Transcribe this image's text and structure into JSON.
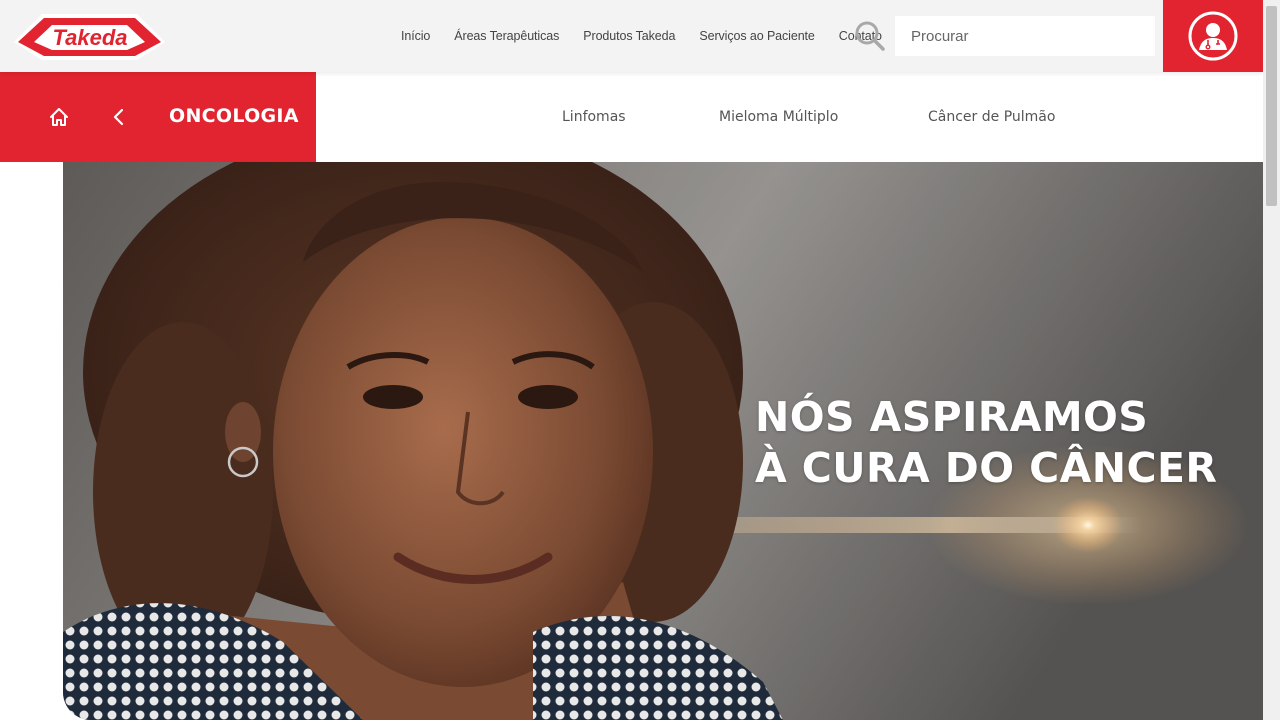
{
  "brand": {
    "name": "Takeda",
    "color": "#e1242f"
  },
  "topnav": {
    "items": [
      {
        "label": "Início"
      },
      {
        "label": "Áreas Terapêuticas"
      },
      {
        "label": "Produtos Takeda"
      },
      {
        "label": "Serviços ao Paciente"
      },
      {
        "label": "Contato"
      }
    ]
  },
  "search": {
    "placeholder": "Procurar",
    "icon": "search-icon"
  },
  "hcp": {
    "icon": "doctor-icon"
  },
  "subnav": {
    "title": "ONCOLOGIA",
    "home_icon": "home-icon",
    "back_icon": "chevron-left-icon",
    "items": [
      {
        "label": "Linfomas"
      },
      {
        "label": "Mieloma Múltiplo"
      },
      {
        "label": "Câncer de Pulmão"
      }
    ]
  },
  "hero": {
    "line1": "NÓS ASPIRAMOS",
    "line2": "À CURA DO CÂNCER"
  }
}
